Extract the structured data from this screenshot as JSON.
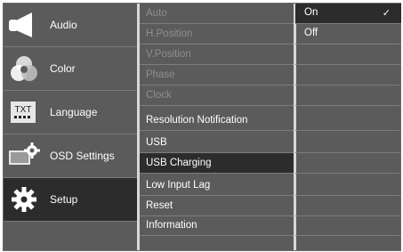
{
  "main_menu": {
    "items": [
      {
        "label": "Audio",
        "icon": "speaker-icon"
      },
      {
        "label": "Color",
        "icon": "color-circles-icon"
      },
      {
        "label": "Language",
        "icon": "txt-keyboard-icon"
      },
      {
        "label": "OSD Settings",
        "icon": "osd-gear-monitor-icon"
      },
      {
        "label": "Setup",
        "icon": "gear-icon",
        "selected": true
      }
    ]
  },
  "sub_menu": {
    "items": [
      {
        "label": "Auto",
        "disabled": true
      },
      {
        "label": "H.Position",
        "disabled": true
      },
      {
        "label": "V.Position",
        "disabled": true
      },
      {
        "label": "Phase",
        "disabled": true
      },
      {
        "label": "Clock",
        "disabled": true
      },
      {
        "label": "Resolution Notification"
      },
      {
        "label": "USB"
      },
      {
        "label": "USB Charging",
        "highlighted": true
      },
      {
        "label": "Low Input Lag"
      },
      {
        "label": "Reset"
      },
      {
        "label": "Information"
      }
    ]
  },
  "options": {
    "items": [
      {
        "label": "On",
        "selected": true,
        "check": "✓"
      },
      {
        "label": "Off"
      }
    ]
  },
  "colors": {
    "panel_bg": "#5b5b5b",
    "selected_bg": "#2c2c2c",
    "separator": "#d8d8d8",
    "disabled_text": "#8f8f8f"
  }
}
